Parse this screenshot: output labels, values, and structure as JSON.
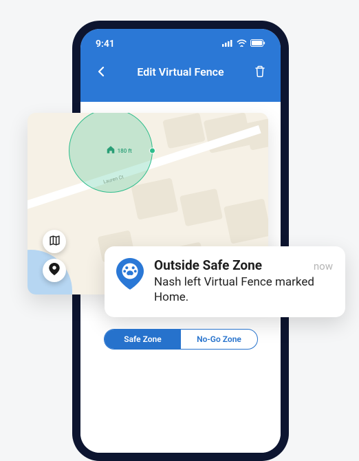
{
  "statusbar": {
    "time": "9:41"
  },
  "header": {
    "title": "Edit Virtual Fence"
  },
  "map": {
    "street_label": "Lauren Ct",
    "geofence_radius": "180 ft"
  },
  "notification": {
    "title": "Outside Safe Zone",
    "time": "now",
    "message": "Nash left Virtual Fence marked Home."
  },
  "segmented": {
    "options": [
      "Safe Zone",
      "No-Go Zone"
    ],
    "active_index": 0
  },
  "colors": {
    "brand_blue": "#2b78d6",
    "fence_green": "#2ebd8c"
  }
}
